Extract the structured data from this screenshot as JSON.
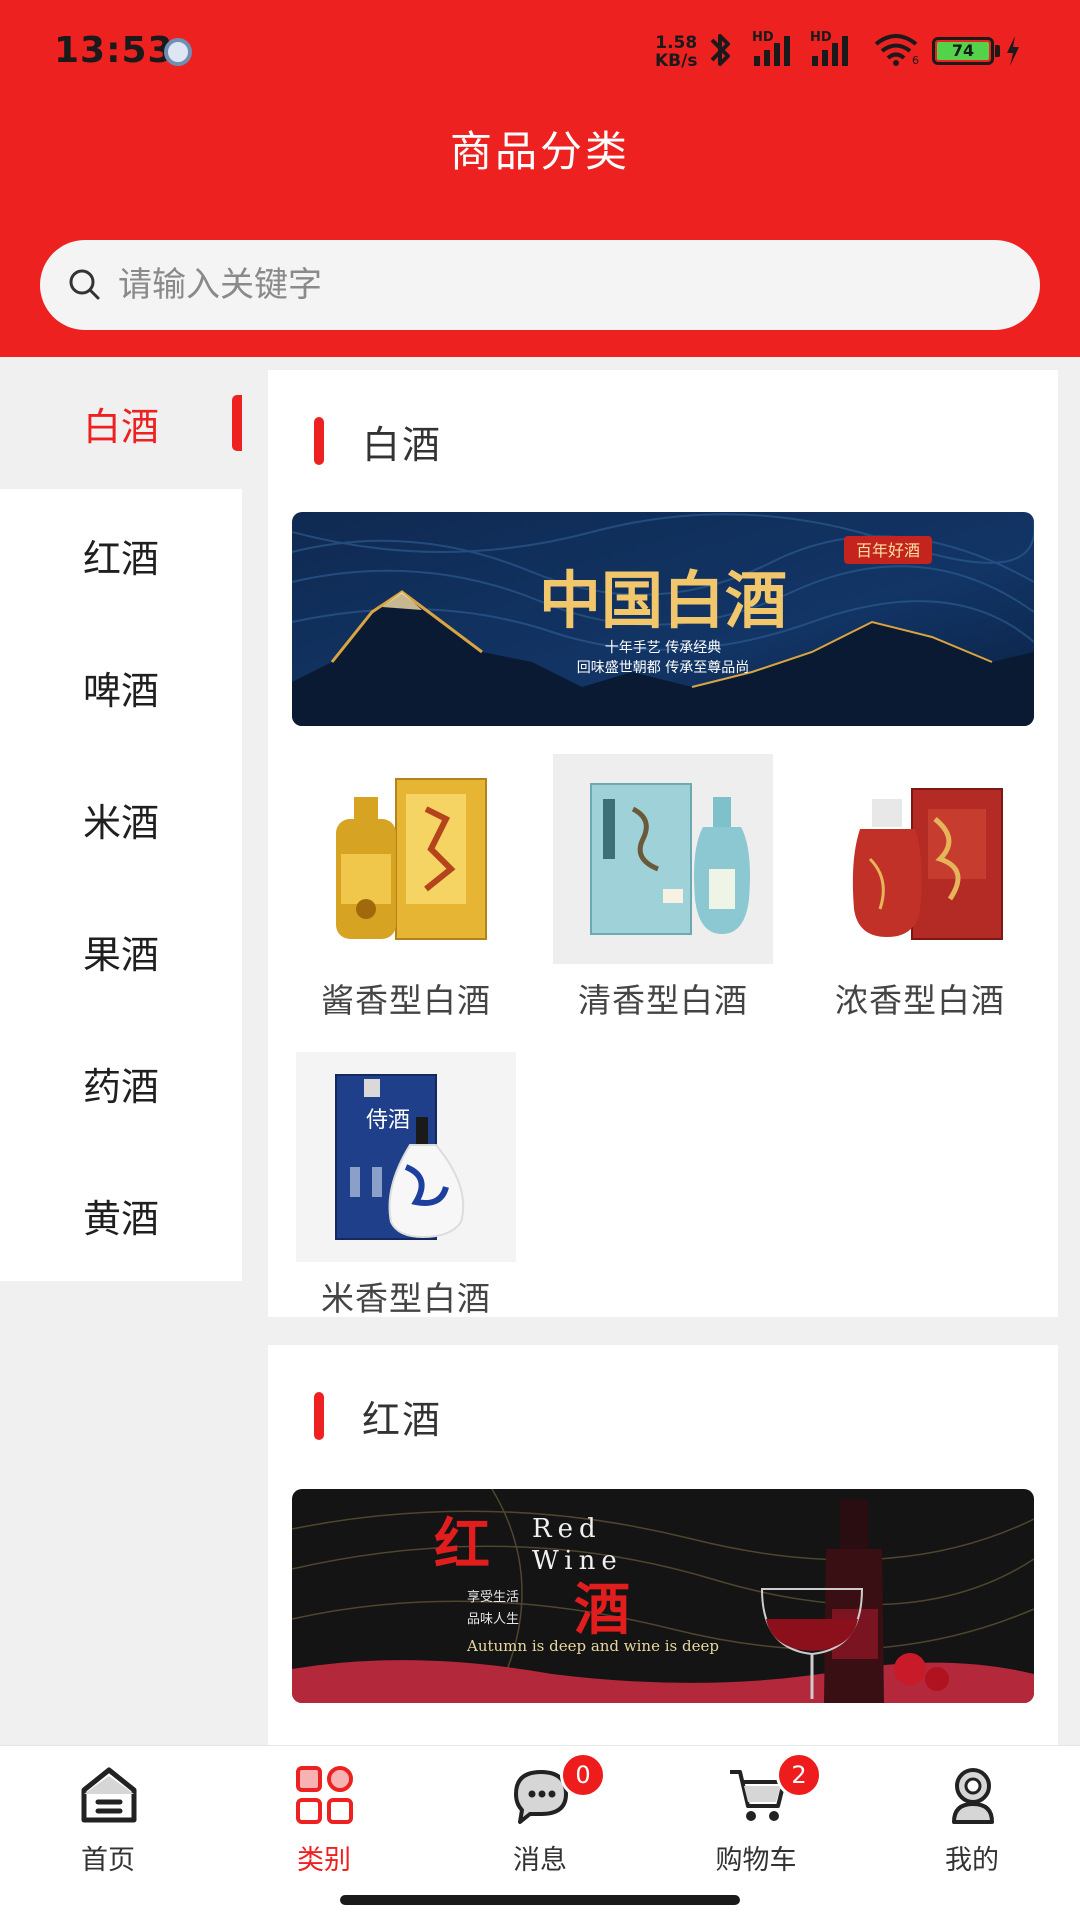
{
  "status_bar": {
    "time": "13:53",
    "net_speed_value": "1.58",
    "net_speed_unit": "KB/s",
    "signal_1_label": "HD",
    "signal_2_label": "HD",
    "wifi_sub": "6",
    "battery": "74",
    "battery_color": "#54d34a"
  },
  "header": {
    "title": "商品分类",
    "bg_color": "#ee2121"
  },
  "search": {
    "placeholder": "请输入关键字",
    "icon": "search-icon"
  },
  "sidebar": {
    "items": [
      {
        "label": "白酒",
        "active": true
      },
      {
        "label": "红酒",
        "active": false
      },
      {
        "label": "啤酒",
        "active": false
      },
      {
        "label": "米酒",
        "active": false
      },
      {
        "label": "果酒",
        "active": false
      },
      {
        "label": "药酒",
        "active": false
      },
      {
        "label": "黄酒",
        "active": false
      }
    ]
  },
  "sections": [
    {
      "title": "白酒",
      "banner": {
        "headline": "中国白酒",
        "tag": "百年好酒",
        "line1": "十年手艺 传承经典",
        "line2": "回味盛世朝都 传承至尊品尚"
      },
      "products": [
        {
          "name": "酱香型白酒"
        },
        {
          "name": "清香型白酒"
        },
        {
          "name": "浓香型白酒"
        },
        {
          "name": "米香型白酒"
        }
      ]
    },
    {
      "title": "红酒",
      "banner": {
        "big1": "红",
        "big2": "酒",
        "en1": "Red",
        "en2": "Wine",
        "line1": "享受生活",
        "line2": "品味人生",
        "tagline": "Autumn is deep and wine is deep"
      }
    }
  ],
  "tabbar": {
    "tabs": [
      {
        "label": "首页",
        "icon": "home-icon",
        "active": false
      },
      {
        "label": "类别",
        "icon": "category-grid-icon",
        "active": true
      },
      {
        "label": "消息",
        "icon": "message-icon",
        "active": false,
        "badge": "0"
      },
      {
        "label": "购物车",
        "icon": "cart-icon",
        "active": false,
        "badge": "2"
      },
      {
        "label": "我的",
        "icon": "user-icon",
        "active": false
      }
    ],
    "active_color": "#ee2121"
  }
}
